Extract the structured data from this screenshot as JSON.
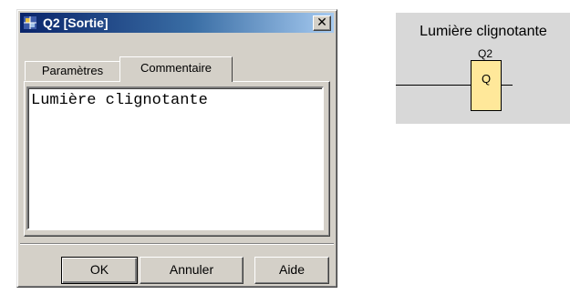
{
  "dialog": {
    "title": "Q2 [Sortie]",
    "title_icon": "block-icon",
    "close_label": "✕",
    "tabs": [
      {
        "label": "Paramètres",
        "active": false
      },
      {
        "label": "Commentaire",
        "active": true
      }
    ],
    "comment_text": "Lumière clignotante",
    "buttons": {
      "ok": "OK",
      "cancel": "Annuler",
      "help": "Aide"
    }
  },
  "symbol": {
    "comment": "Lumière clignotante",
    "block_id": "Q2",
    "block_type": "Q",
    "fill_color": "#ffe89a"
  }
}
